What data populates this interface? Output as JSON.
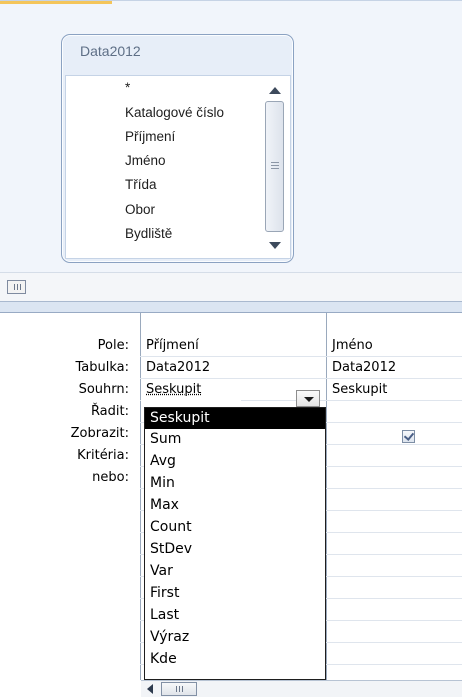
{
  "table_box": {
    "title": "Data2012",
    "fields": [
      "*",
      "Katalogové číslo",
      "Příjmení",
      "Jméno",
      "Třída",
      "Obor",
      "Bydliště"
    ]
  },
  "grid": {
    "row_labels": {
      "field": "Pole:",
      "table": "Tabulka:",
      "total": "Souhrn:",
      "sort": "Řadit:",
      "show": "Zobrazit:",
      "criteria": "Kritéria:",
      "or": "nebo:"
    },
    "columns": [
      {
        "field": "Příjmení",
        "table": "Data2012",
        "total": "Seskupit"
      },
      {
        "field": "Jméno",
        "table": "Data2012",
        "total": "Seskupit",
        "show": true
      }
    ]
  },
  "total_dropdown": {
    "selected": "Seskupit",
    "options": [
      "Seskupit",
      "Sum",
      "Avg",
      "Min",
      "Max",
      "Count",
      "StDev",
      "Var",
      "First",
      "Last",
      "Výraz",
      "Kde"
    ]
  },
  "icons": [
    "scroll-up-arrow-icon",
    "scroll-down-arrow-icon",
    "scroll-thumb-grip-icon",
    "dropdown-arrow-icon",
    "checkbox-checked-icon",
    "scroll-left-arrow-icon"
  ],
  "colors": {
    "pane_background": "#f1f5fb",
    "table_border": "#8ba2c2",
    "dropdown_highlight": "#000000"
  }
}
